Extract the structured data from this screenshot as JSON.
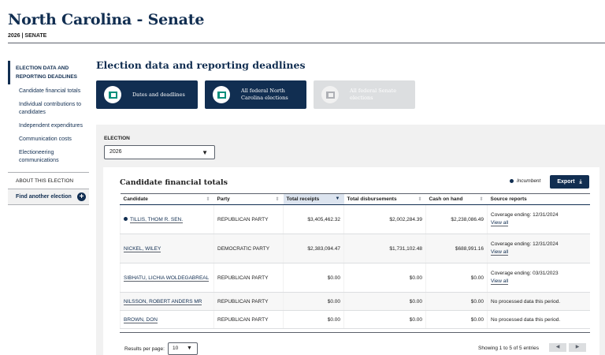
{
  "header": {
    "title": "North Carolina - Senate",
    "subtitle": "2026 | SENATE"
  },
  "sidebar": {
    "section": "ELECTION DATA AND REPORTING DEADLINES",
    "items": [
      {
        "label": "Candidate financial totals"
      },
      {
        "label": "Individual contributions to candidates"
      },
      {
        "label": "Independent expenditures"
      },
      {
        "label": "Communication costs"
      },
      {
        "label": "Electioneering communications"
      }
    ],
    "about": "ABOUT THIS ELECTION",
    "find": "Find another election"
  },
  "main": {
    "title": "Election data and reporting deadlines",
    "cards": [
      {
        "label": "Dates and deadlines",
        "enabled": true
      },
      {
        "label": "All federal North Carolina elections",
        "enabled": true
      },
      {
        "label": "All federal Senate elections",
        "enabled": false
      }
    ],
    "election_label": "ELECTION",
    "election_value": "2026"
  },
  "table": {
    "title": "Candidate financial totals",
    "incumbent_label": "Incumbent",
    "export_label": "Export",
    "columns": [
      "Candidate",
      "Party",
      "Total receipts",
      "Total disbursements",
      "Cash on hand",
      "Source reports"
    ],
    "rows": [
      {
        "candidate": "TILLIS, THOM R. SEN.",
        "incumbent": true,
        "party": "REPUBLICAN PARTY",
        "receipts": "$3,405,462.32",
        "disbursements": "$2,002,284.39",
        "cash": "$2,238,086.49",
        "source": "Coverage ending: 12/31/2024",
        "view": "View all"
      },
      {
        "candidate": "NICKEL, WILEY",
        "incumbent": false,
        "party": "DEMOCRATIC PARTY",
        "receipts": "$2,383,094.47",
        "disbursements": "$1,731,102.48",
        "cash": "$688,991.16",
        "source": "Coverage ending: 12/31/2024",
        "view": "View all"
      },
      {
        "candidate": "SIBHATU, LICHIA WOLDEGABREAL",
        "incumbent": false,
        "party": "REPUBLICAN PARTY",
        "receipts": "$0.00",
        "disbursements": "$0.00",
        "cash": "$0.00",
        "source": "Coverage ending: 03/31/2023",
        "view": "View all"
      },
      {
        "candidate": "NILSSON, ROBERT ANDERS MR",
        "incumbent": false,
        "party": "REPUBLICAN PARTY",
        "receipts": "$0.00",
        "disbursements": "$0.00",
        "cash": "$0.00",
        "source": "No processed data this period.",
        "view": ""
      },
      {
        "candidate": "BROWN, DON",
        "incumbent": false,
        "party": "REPUBLICAN PARTY",
        "receipts": "$0.00",
        "disbursements": "$0.00",
        "cash": "$0.00",
        "source": "No processed data this period.",
        "view": ""
      }
    ],
    "results_per_page_label": "Results per page:",
    "results_per_page_value": "10",
    "showing": "Showing 1 to 5 of 5 entries"
  }
}
